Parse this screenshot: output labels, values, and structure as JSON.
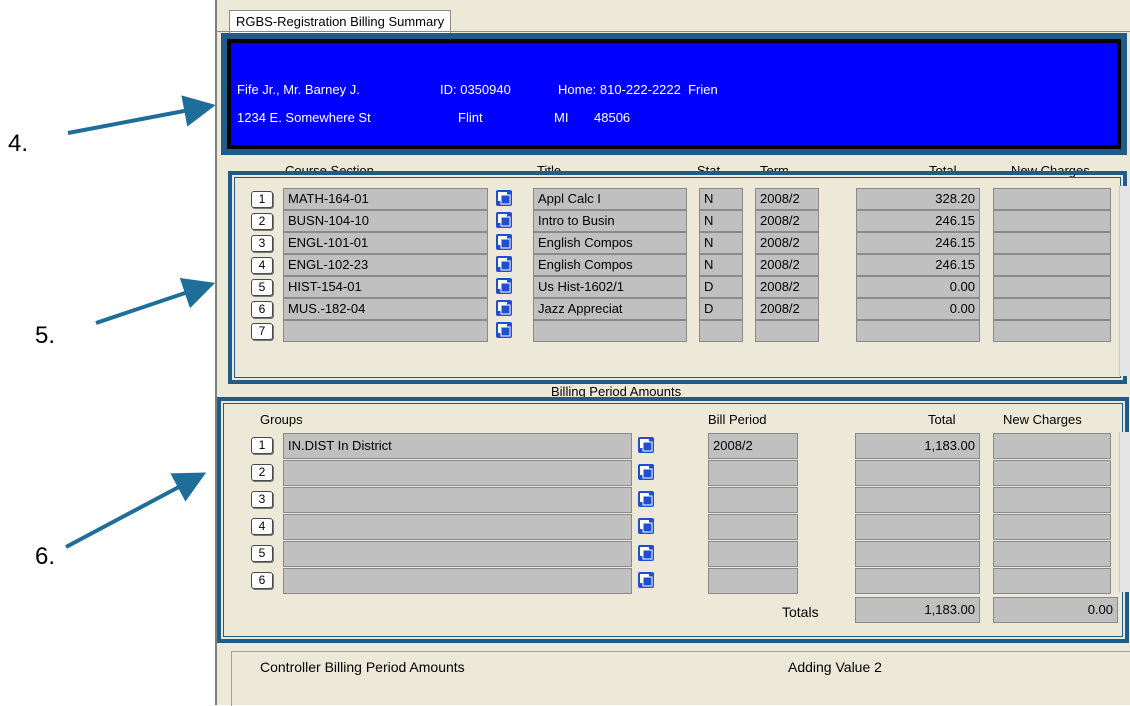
{
  "annotations": [
    "4.",
    "5.",
    "6."
  ],
  "window": {
    "tab_label": "RGBS-Registration Billing Summary"
  },
  "header": {
    "name": "Fife Jr., Mr. Barney J.",
    "id": "ID: 0350940",
    "home": "Home: 810-222-2222  Frien",
    "address": "1234 E. Somewhere St",
    "city": "Flint",
    "state": "MI",
    "zip": "48506"
  },
  "courses": {
    "headers": {
      "section": "Course Section",
      "title": "Title",
      "stat": "Stat",
      "term": "Term",
      "total": "Total",
      "new_charges": "New Charges"
    },
    "rows": [
      {
        "num": "1",
        "section": "MATH-164-01",
        "title": "Appl Calc I",
        "stat": "N",
        "term": "2008/2",
        "total": "328.20",
        "new": ""
      },
      {
        "num": "2",
        "section": "BUSN-104-10",
        "title": "Intro to Busin",
        "stat": "N",
        "term": "2008/2",
        "total": "246.15",
        "new": ""
      },
      {
        "num": "3",
        "section": "ENGL-101-01",
        "title": "English Compos",
        "stat": "N",
        "term": "2008/2",
        "total": "246.15",
        "new": ""
      },
      {
        "num": "4",
        "section": "ENGL-102-23",
        "title": "English Compos",
        "stat": "N",
        "term": "2008/2",
        "total": "246.15",
        "new": ""
      },
      {
        "num": "5",
        "section": "HIST-154-01",
        "title": "Us Hist-1602/1",
        "stat": "D",
        "term": "2008/2",
        "total": "0.00",
        "new": ""
      },
      {
        "num": "6",
        "section": "MUS.-182-04",
        "title": "Jazz Appreciat",
        "stat": "D",
        "term": "2008/2",
        "total": "0.00",
        "new": ""
      },
      {
        "num": "7",
        "section": "",
        "title": "",
        "stat": "",
        "term": "",
        "total": "",
        "new": ""
      }
    ]
  },
  "billing": {
    "label": "Billing Period Amounts",
    "headers": {
      "groups": "Groups",
      "bill_period": "Bill Period",
      "total": "Total",
      "new_charges": "New Charges"
    },
    "rows": [
      {
        "num": "1",
        "group": "IN.DIST In District",
        "period": "2008/2",
        "total": "1,183.00",
        "new": ""
      },
      {
        "num": "2",
        "group": "",
        "period": "",
        "total": "",
        "new": ""
      },
      {
        "num": "3",
        "group": "",
        "period": "",
        "total": "",
        "new": ""
      },
      {
        "num": "4",
        "group": "",
        "period": "",
        "total": "",
        "new": ""
      },
      {
        "num": "5",
        "group": "",
        "period": "",
        "total": "",
        "new": ""
      },
      {
        "num": "6",
        "group": "",
        "period": "",
        "total": "",
        "new": ""
      }
    ],
    "totals_label": "Totals",
    "totals_total": "1,183.00",
    "totals_new": "0.00"
  },
  "footer": {
    "left": "Controller Billing Period Amounts",
    "right": "Adding Value 2"
  },
  "icons": {
    "lookup": "lookup-icon",
    "arrow": "annotation-arrow"
  },
  "colors": {
    "header_bg": "#0000ff",
    "frame": "#1f5c8a",
    "cell": "#c0c0c0",
    "window": "#ece9d8"
  }
}
